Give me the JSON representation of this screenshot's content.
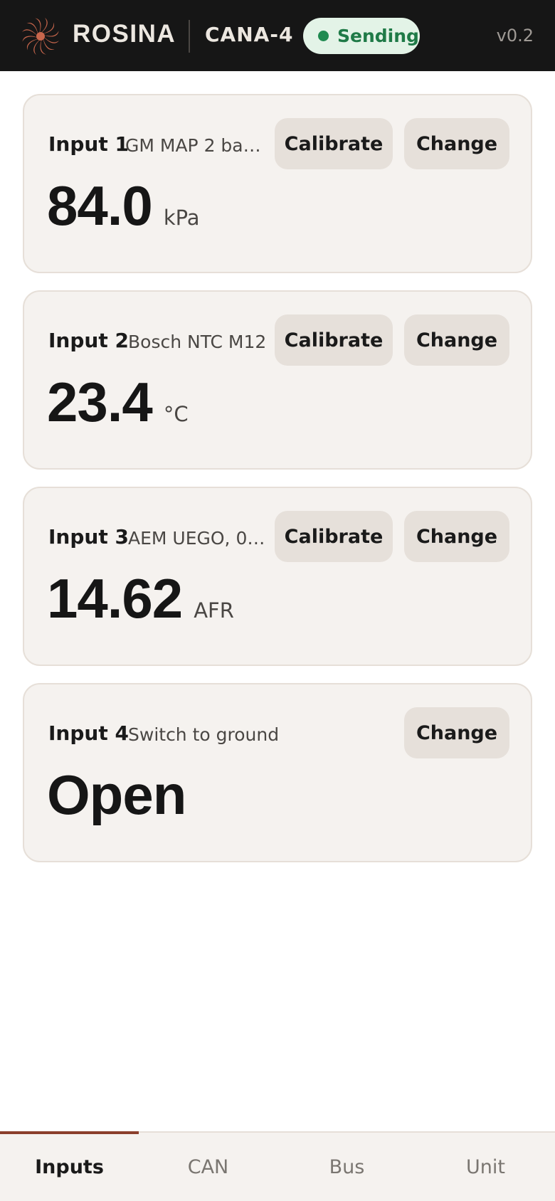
{
  "header": {
    "brand": "ROSINA",
    "device": "CANA-4",
    "status": "Sending",
    "version": "v0.2",
    "status_color": "#1f8a50",
    "logo_icon": "swirl-logo-icon",
    "logo_color": "#c8664c"
  },
  "inputs": [
    {
      "label": "Input 1",
      "sensor": "GM MAP 2 bar...",
      "value": "84.0",
      "unit": "kPa",
      "calibrate_label": "Calibrate",
      "change_label": "Change"
    },
    {
      "label": "Input 2",
      "sensor": "Bosch NTC M12",
      "value": "23.4",
      "unit": "°C",
      "calibrate_label": "Calibrate",
      "change_label": "Change"
    },
    {
      "label": "Input 3",
      "sensor": "AEM UEGO, 0–...",
      "value": "14.62",
      "unit": "AFR",
      "calibrate_label": "Calibrate",
      "change_label": "Change"
    },
    {
      "label": "Input 4",
      "sensor": "Switch to ground",
      "value": "Open",
      "change_label": "Change"
    }
  ],
  "tabs": [
    {
      "label": "Inputs",
      "active": true
    },
    {
      "label": "CAN",
      "active": false
    },
    {
      "label": "Bus",
      "active": false
    },
    {
      "label": "Unit",
      "active": false
    }
  ],
  "colors": {
    "accent": "#8b3f2c",
    "card_bg": "#f5f2ef",
    "button_bg": "#e6e0da"
  }
}
